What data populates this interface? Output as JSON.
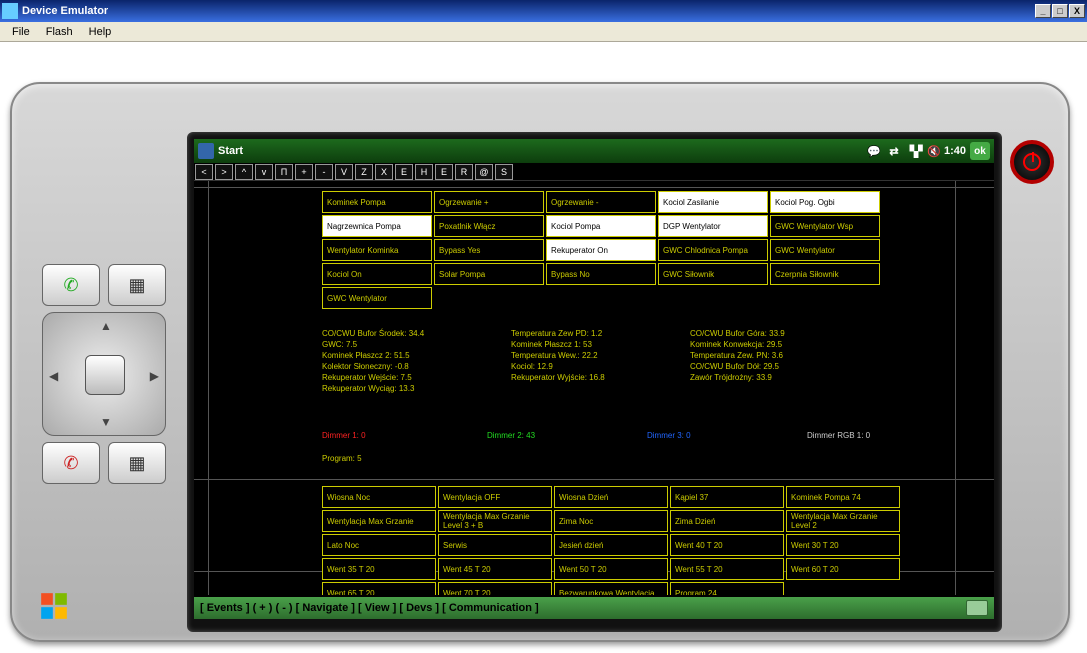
{
  "window": {
    "title": "Device Emulator"
  },
  "menu": [
    "File",
    "Flash",
    "Help"
  ],
  "wm": {
    "start": "Start",
    "time": "1:40",
    "ok": "ok"
  },
  "toolbar": [
    "<",
    ">",
    "^",
    "v",
    "Π",
    "+",
    "-",
    "V",
    "Z",
    "X",
    "E",
    "H",
    "E",
    "R",
    "@",
    "S"
  ],
  "events": [
    {
      "t": "Kominek Pompa",
      "a": 0
    },
    {
      "t": "Ogrzewanie +",
      "a": 0
    },
    {
      "t": "Ogrzewanie -",
      "a": 0
    },
    {
      "t": "Kociol Zasilanie",
      "a": 1
    },
    {
      "t": "Kociol Pog. Ogbi",
      "a": 1
    },
    {
      "t": "Nagrzewnica Pompa",
      "a": 1
    },
    {
      "t": "Poxatlnik Włącz",
      "a": 0
    },
    {
      "t": "Kociol Pompa",
      "a": 1
    },
    {
      "t": "DGP Wentylator",
      "a": 1
    },
    {
      "t": "GWC Wentylator Wsp",
      "a": 0
    },
    {
      "t": "Wentylator Kominka",
      "a": 0
    },
    {
      "t": "Bypass Yes",
      "a": 0
    },
    {
      "t": "Rekuperator On",
      "a": 1
    },
    {
      "t": "GWC Chlodnica Pompa",
      "a": 0
    },
    {
      "t": "GWC Wentylator",
      "a": 0
    },
    {
      "t": "Kociol On",
      "a": 0
    },
    {
      "t": "Solar Pompa",
      "a": 0
    },
    {
      "t": "Bypass No",
      "a": 0
    },
    {
      "t": "GWC Siłownik",
      "a": 0
    },
    {
      "t": "Czerpnia Siłownik",
      "a": 0
    },
    {
      "t": "GWC Wentylator",
      "a": 0
    }
  ],
  "status": [
    "CO/CWU Bufor Środek: 34.4",
    "Temperatura Zew PD: 1.2",
    "CO/CWU Bufor Góra: 33.9",
    "GWC: 7.5",
    "Kominek Płaszcz 1: 53",
    "Kominek Konwekcja: 29.5",
    "Kominek Płaszcz 2: 51.5",
    "Temperatura Wew.: 22.2",
    "Temperatura Zew. PN: 3.6",
    "Kolektor Słoneczny: -0.8",
    "Kociol: 12.9",
    "CO/CWU Bufor Dół: 29.5",
    "Rekuperator Wejście: 7.5",
    "Rekuperator Wyjście: 16.8",
    "Zawór Trójdrożny: 33.9",
    "Rekuperator Wyciąg: 13.3",
    "",
    ""
  ],
  "dimmers": [
    "Dimmer 1: 0",
    "Dimmer 2: 43",
    "Dimmer 3: 0",
    "Dimmer RGB 1: 0"
  ],
  "program_label": "Program: 5",
  "programs": [
    "Wiosna Noc",
    "Wentylacja OFF",
    "Wiosna Dzień",
    "Kąpiel 37",
    "Kominek Pompa 74",
    "Wentylacja Max Grzanie",
    "Wentylacja Max Grzanie Level 3 + B",
    "Zima Noc",
    "Zima Dzień",
    "Wentylacja Max Grzanie Level 2",
    "Lato Noc",
    "Serwis",
    "Jesień dzień",
    "Went 40 T 20",
    "Went 30 T 20",
    "Went 35 T 20",
    "Went 45 T 20",
    "Went 50 T 20",
    "Went 55 T 20",
    "Went 60 T 20",
    "Went 65 T 20",
    "Went 70 T 20",
    "Bezwarunkowa Wentylacja",
    "Program 24",
    ""
  ],
  "footer": "[ Events ]  (   +  )  (   -   )  [ Navigate ]  [ View ]  [ Devs ]  [ Communication ]"
}
